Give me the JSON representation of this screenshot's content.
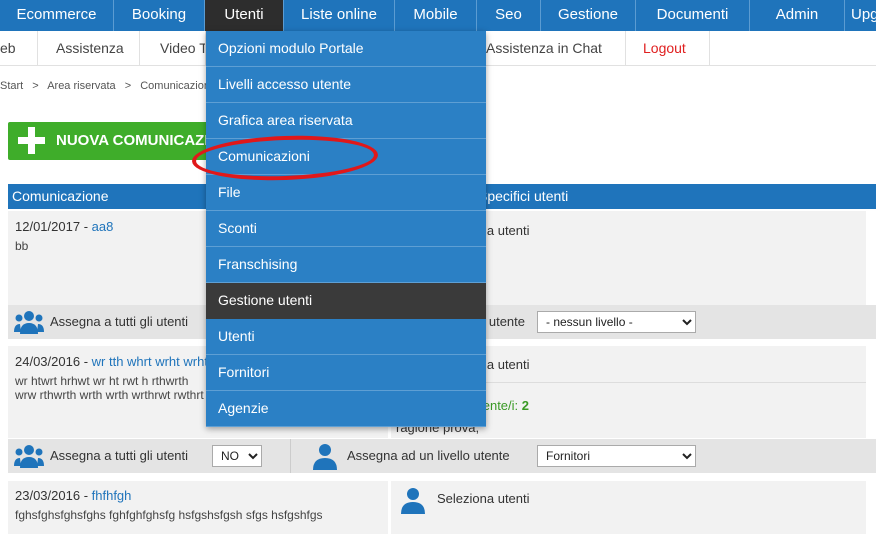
{
  "topnav": {
    "items": [
      {
        "label": "Ecommerce"
      },
      {
        "label": "Booking"
      },
      {
        "label": "Utenti"
      },
      {
        "label": "Liste online"
      },
      {
        "label": "Mobile"
      },
      {
        "label": "Seo"
      },
      {
        "label": "Gestione"
      },
      {
        "label": "Documenti"
      },
      {
        "label": "Admin"
      },
      {
        "label": "Upg"
      }
    ]
  },
  "subnav": {
    "items": [
      {
        "label": "eb"
      },
      {
        "label": "Assistenza"
      },
      {
        "label": "Video T"
      },
      {
        "label": "Assistenza in Chat"
      },
      {
        "label": "Logout"
      }
    ]
  },
  "breadcrumb": {
    "items": [
      "Start",
      ">",
      "Area riservata",
      ">",
      "Comunicazioni"
    ]
  },
  "new_button": {
    "label": "NUOVA COMUNICAZIONE"
  },
  "table": {
    "headers": [
      "Comunicazione",
      "Specifici utenti"
    ]
  },
  "rows": [
    {
      "date": "12/01/2017",
      "sep": " - ",
      "title": "aa8",
      "desc": [
        "bb"
      ],
      "right_text": "Seleziona utenti",
      "assign_all_label": "Assegna a tutti gli utenti",
      "assign_level_label": "Assegna ad un livello utente",
      "level_value": "- nessun livello -"
    },
    {
      "date": "24/03/2016",
      "sep": " - ",
      "title": "wr tth whrt wrht wrht",
      "desc": [
        "wr htwrt hrhwt wr ht rwt h  rthwrth",
        "wrw rthwrth wrth wrth wrthrwt rwthrt"
      ],
      "right_text": "Seleziona utenti",
      "assigned_label": "Assegnato a utente/i:",
      "assigned_count": "2",
      "company": "ragione prova,",
      "assign_all_label": "Assegna a tutti gli utenti",
      "assign_all_value": "NO",
      "assign_level_label": "Assegna ad un livello utente",
      "level_value": "Fornitori"
    },
    {
      "date": "23/03/2016",
      "sep": " - ",
      "title": "fhfhfgh",
      "desc": [
        "fghsfghsfghsfghs fghfghfghsfg hsfgshsfgsh sfgs hsfgshfgs"
      ],
      "right_text": "Seleziona utenti"
    }
  ],
  "dropdown": {
    "items": [
      {
        "label": "Opzioni modulo Portale"
      },
      {
        "label": "Livelli accesso utente"
      },
      {
        "label": "Grafica area riservata"
      },
      {
        "label": "Comunicazioni"
      },
      {
        "label": "File"
      },
      {
        "label": "Sconti"
      },
      {
        "label": "Franschising"
      },
      {
        "label": "Gestione utenti"
      },
      {
        "label": "Utenti"
      },
      {
        "label": "Fornitori"
      },
      {
        "label": "Agenzie"
      }
    ]
  },
  "colors": {
    "nav_blue": "#1f74bb",
    "menu_blue": "#2b80c5",
    "highlight_dark": "#3a3a3a",
    "green_button": "#3fad2a",
    "annotation_red": "#e0181a"
  }
}
